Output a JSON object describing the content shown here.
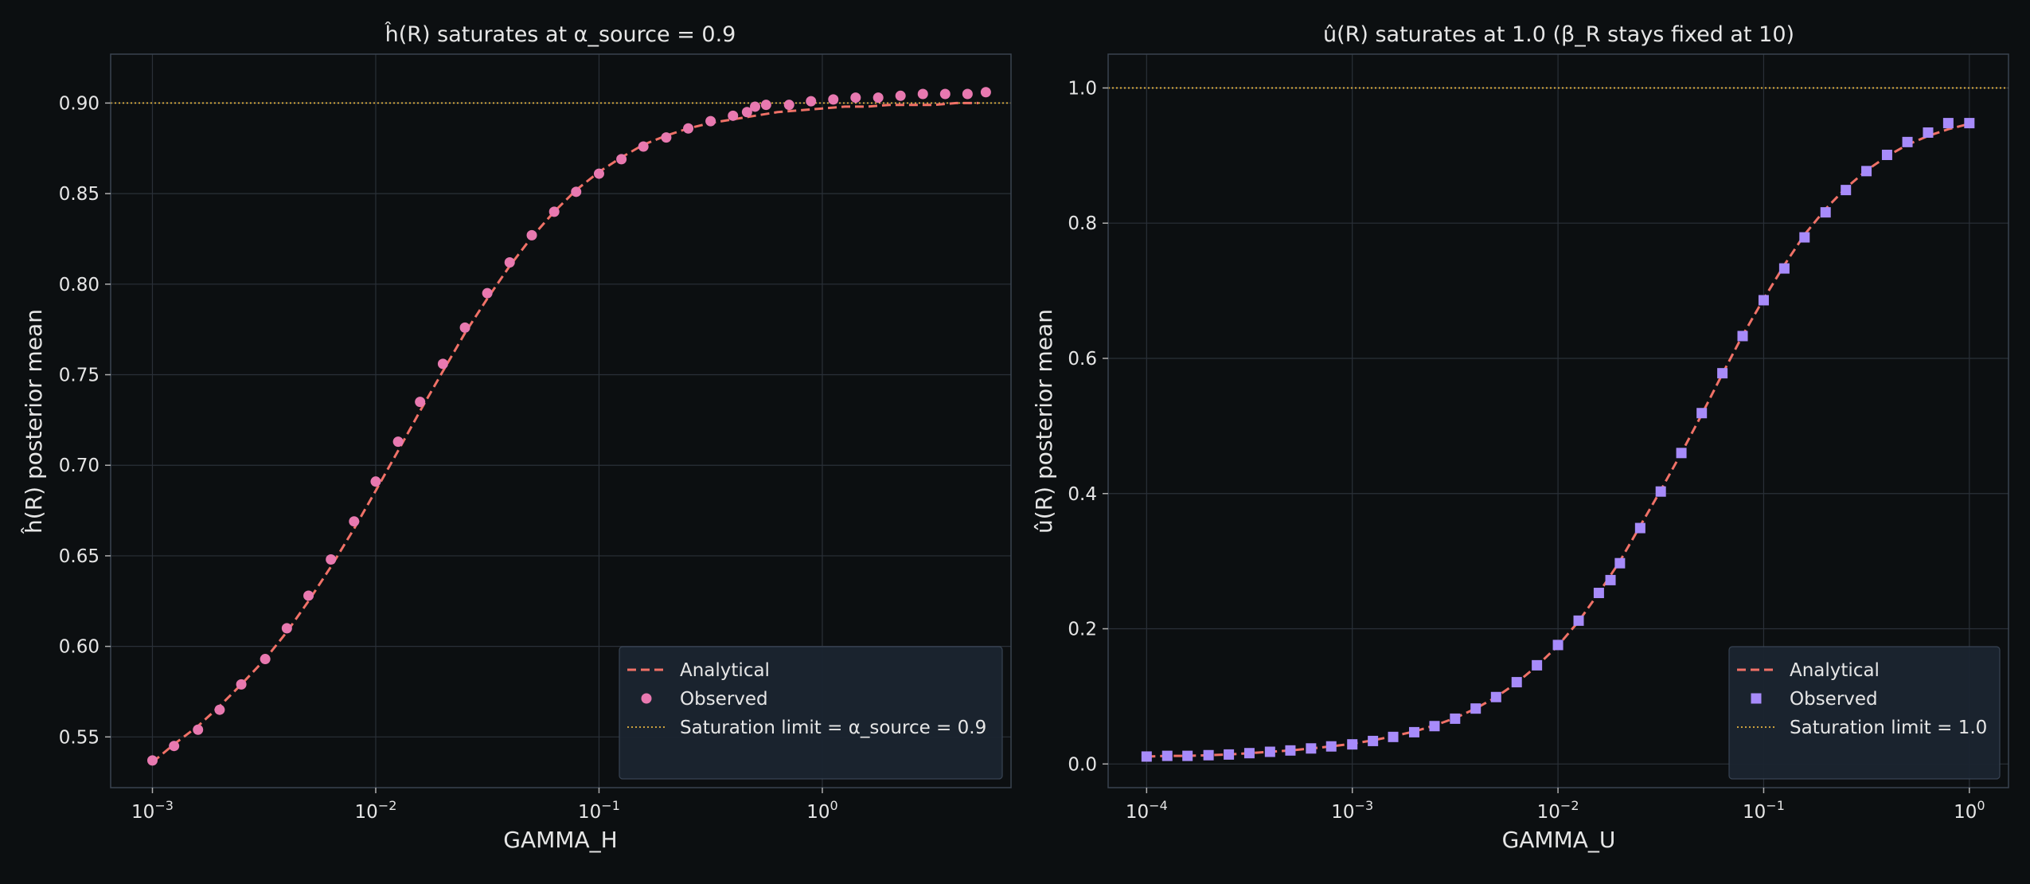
{
  "chart_data": [
    {
      "type": "scatter",
      "title": "ĥ(R) saturates at α_source = 0.9",
      "xlabel": "GAMMA_H",
      "ylabel": "ĥ(R) posterior mean",
      "xscale": "log",
      "xlim": [
        0.00065,
        7.0
      ],
      "ylim": [
        0.522,
        0.927
      ],
      "xticks": [
        {
          "value": 0.001,
          "base": "10",
          "exp": "−3"
        },
        {
          "value": 0.01,
          "base": "10",
          "exp": "−2"
        },
        {
          "value": 0.1,
          "base": "10",
          "exp": "−1"
        },
        {
          "value": 1,
          "base": "10",
          "exp": "0"
        }
      ],
      "yticks": [
        {
          "value": 0.55,
          "label": "0.55"
        },
        {
          "value": 0.6,
          "label": "0.60"
        },
        {
          "value": 0.65,
          "label": "0.65"
        },
        {
          "value": 0.7,
          "label": "0.70"
        },
        {
          "value": 0.75,
          "label": "0.75"
        },
        {
          "value": 0.8,
          "label": "0.80"
        },
        {
          "value": 0.85,
          "label": "0.85"
        },
        {
          "value": 0.9,
          "label": "0.90"
        }
      ],
      "grid": true,
      "legend_position": "lower right",
      "saturation": 0.9,
      "analytical": {
        "name": "Analytical",
        "color": "#f07167",
        "x": [
          0.001,
          0.00125,
          0.0016,
          0.002,
          0.0025,
          0.0032,
          0.004,
          0.005,
          0.0063,
          0.008,
          0.01,
          0.0126,
          0.0158,
          0.02,
          0.0251,
          0.0316,
          0.0398,
          0.05,
          0.063,
          0.079,
          0.1,
          0.126,
          0.158,
          0.2,
          0.251,
          0.316,
          0.398,
          0.5,
          0.63,
          0.79,
          1.0,
          1.26,
          1.58,
          2.0,
          2.51,
          3.16,
          3.98,
          5.0
        ],
        "y": [
          0.536,
          0.546,
          0.556,
          0.567,
          0.579,
          0.593,
          0.608,
          0.625,
          0.644,
          0.665,
          0.686,
          0.708,
          0.73,
          0.752,
          0.773,
          0.792,
          0.81,
          0.826,
          0.84,
          0.852,
          0.862,
          0.87,
          0.877,
          0.882,
          0.886,
          0.889,
          0.891,
          0.893,
          0.895,
          0.896,
          0.897,
          0.898,
          0.898,
          0.899,
          0.899,
          0.899,
          0.9,
          0.9
        ]
      },
      "observed": {
        "name": "Observed",
        "color": "#e879b0",
        "marker": "circle",
        "x": [
          0.001,
          0.00125,
          0.0016,
          0.002,
          0.0025,
          0.0032,
          0.004,
          0.005,
          0.0063,
          0.008,
          0.01,
          0.0126,
          0.0158,
          0.02,
          0.0251,
          0.0316,
          0.0398,
          0.05,
          0.063,
          0.079,
          0.1,
          0.126,
          0.158,
          0.2,
          0.251,
          0.316,
          0.398,
          0.46,
          0.5,
          0.56,
          0.71,
          0.89,
          1.12,
          1.41,
          1.78,
          2.24,
          2.82,
          3.55,
          4.47,
          5.4
        ],
        "y": [
          0.537,
          0.545,
          0.554,
          0.565,
          0.579,
          0.593,
          0.61,
          0.628,
          0.648,
          0.669,
          0.691,
          0.713,
          0.735,
          0.756,
          0.776,
          0.795,
          0.812,
          0.827,
          0.84,
          0.851,
          0.861,
          0.869,
          0.876,
          0.881,
          0.886,
          0.89,
          0.893,
          0.895,
          0.898,
          0.899,
          0.899,
          0.901,
          0.902,
          0.903,
          0.903,
          0.904,
          0.905,
          0.905,
          0.905,
          0.906
        ]
      },
      "saturation_line": {
        "name": "Saturation limit = α_source = 0.9",
        "color": "#e3b341"
      }
    },
    {
      "type": "scatter",
      "title": "û(R) saturates at 1.0 (β_R stays fixed at 10)",
      "xlabel": "GAMMA_U",
      "ylabel": "û(R) posterior mean",
      "xscale": "log",
      "xlim": [
        6.5e-05,
        1.55
      ],
      "ylim": [
        -0.035,
        1.05
      ],
      "xticks": [
        {
          "value": 0.0001,
          "base": "10",
          "exp": "−4"
        },
        {
          "value": 0.001,
          "base": "10",
          "exp": "−3"
        },
        {
          "value": 0.01,
          "base": "10",
          "exp": "−2"
        },
        {
          "value": 0.1,
          "base": "10",
          "exp": "−1"
        },
        {
          "value": 1,
          "base": "10",
          "exp": "0"
        }
      ],
      "yticks": [
        {
          "value": 0.0,
          "label": "0.0"
        },
        {
          "value": 0.2,
          "label": "0.2"
        },
        {
          "value": 0.4,
          "label": "0.4"
        },
        {
          "value": 0.6,
          "label": "0.6"
        },
        {
          "value": 0.8,
          "label": "0.8"
        },
        {
          "value": 1.0,
          "label": "1.0"
        }
      ],
      "grid": true,
      "legend_position": "lower right",
      "saturation": 1.0,
      "analytical": {
        "name": "Analytical",
        "color": "#f07167",
        "x": [
          0.0001,
          0.000126,
          0.000158,
          0.0002,
          0.000251,
          0.000316,
          0.000398,
          0.0005,
          0.00063,
          0.00079,
          0.001,
          0.00126,
          0.00158,
          0.002,
          0.00251,
          0.00316,
          0.00398,
          0.005,
          0.0063,
          0.0079,
          0.01,
          0.0126,
          0.0158,
          0.02,
          0.0251,
          0.0316,
          0.0398,
          0.05,
          0.063,
          0.079,
          0.1,
          0.126,
          0.158,
          0.2,
          0.251,
          0.316,
          0.398,
          0.5,
          0.63,
          0.79,
          1.0
        ],
        "y": [
          0.011,
          0.012,
          0.012,
          0.013,
          0.014,
          0.016,
          0.018,
          0.02,
          0.023,
          0.026,
          0.03,
          0.035,
          0.041,
          0.048,
          0.057,
          0.068,
          0.082,
          0.099,
          0.12,
          0.145,
          0.175,
          0.211,
          0.253,
          0.3,
          0.352,
          0.405,
          0.46,
          0.517,
          0.577,
          0.634,
          0.688,
          0.738,
          0.783,
          0.821,
          0.852,
          0.878,
          0.899,
          0.916,
          0.929,
          0.939,
          0.947
        ]
      },
      "observed": {
        "name": "Observed",
        "color": "#a78bfa",
        "marker": "square",
        "x": [
          0.0001,
          0.000126,
          0.000158,
          0.0002,
          0.000251,
          0.000316,
          0.000398,
          0.0005,
          0.00063,
          0.00079,
          0.001,
          0.00126,
          0.00158,
          0.002,
          0.00251,
          0.00316,
          0.00398,
          0.005,
          0.0063,
          0.0079,
          0.01,
          0.0126,
          0.0158,
          0.018,
          0.02,
          0.0251,
          0.0316,
          0.0398,
          0.05,
          0.063,
          0.079,
          0.1,
          0.126,
          0.158,
          0.2,
          0.251,
          0.316,
          0.398,
          0.5,
          0.63,
          0.79,
          1.0
        ],
        "y": [
          0.011,
          0.012,
          0.012,
          0.013,
          0.014,
          0.016,
          0.018,
          0.02,
          0.023,
          0.026,
          0.029,
          0.034,
          0.04,
          0.047,
          0.056,
          0.067,
          0.082,
          0.099,
          0.121,
          0.146,
          0.176,
          0.212,
          0.253,
          0.272,
          0.297,
          0.349,
          0.403,
          0.46,
          0.519,
          0.578,
          0.633,
          0.686,
          0.733,
          0.779,
          0.816,
          0.849,
          0.877,
          0.901,
          0.92,
          0.934,
          0.948,
          0.948
        ]
      },
      "saturation_line": {
        "name": "Saturation limit = 1.0",
        "color": "#e3b341"
      }
    }
  ]
}
